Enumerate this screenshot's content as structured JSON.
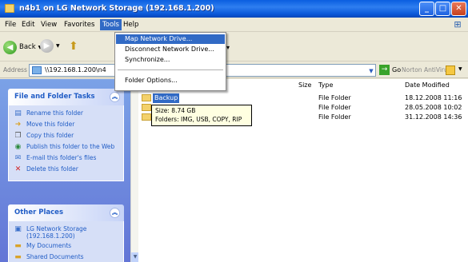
{
  "window": {
    "title": "n4b1 on LG Network Storage (192.168.1.200)"
  },
  "menubar": {
    "items": [
      "File",
      "Edit",
      "View",
      "Favorites",
      "Tools",
      "Help"
    ]
  },
  "toolbar": {
    "back_label": "Back"
  },
  "address": {
    "label": "Address",
    "value": "\\\\192.168.1.200\\n4",
    "go_label": "Go",
    "norton_label": "Norton AntiVirus"
  },
  "tools_menu": {
    "items": [
      "Map Network Drive...",
      "Disconnect Network Drive...",
      "Synchronize...",
      "Folder Options..."
    ]
  },
  "left_pane": {
    "file_folder_tasks": {
      "title": "File and Folder Tasks",
      "tasks": [
        {
          "label": "Rename this folder",
          "icon": "rename-icon"
        },
        {
          "label": "Move this folder",
          "icon": "move-icon"
        },
        {
          "label": "Copy this folder",
          "icon": "copy-icon"
        },
        {
          "label": "Publish this folder to the Web",
          "icon": "globe-icon"
        },
        {
          "label": "E-mail this folder's files",
          "icon": "email-icon"
        },
        {
          "label": "Delete this folder",
          "icon": "delete-icon"
        }
      ]
    },
    "other_places": {
      "title": "Other Places",
      "places": [
        {
          "label": "LG Network Storage (192.168.1.200)",
          "icon": "network-storage-icon"
        },
        {
          "label": "My Documents",
          "icon": "folder-icon"
        },
        {
          "label": "Shared Documents",
          "icon": "folder-icon"
        }
      ]
    }
  },
  "list": {
    "columns": {
      "size": "Size",
      "type": "Type",
      "modified": "Date Modified"
    },
    "rows": [
      {
        "name": "Backup",
        "size": "",
        "type": "File Folder",
        "modified": "18.12.2008 11:16"
      },
      {
        "name": "",
        "size": "",
        "type": "File Folder",
        "modified": "28.05.2008 10:02"
      },
      {
        "name": "",
        "size": "",
        "type": "File Folder",
        "modified": "31.12.2008 14:36"
      }
    ]
  },
  "tooltip": {
    "line1": "Size: 8.74 GB",
    "line2": "Folders: IMG, USB, COPY, RIP"
  },
  "colors": {
    "selection": "#316ac5",
    "titlebar": "#0a58d8",
    "task_link": "#215dc6"
  }
}
